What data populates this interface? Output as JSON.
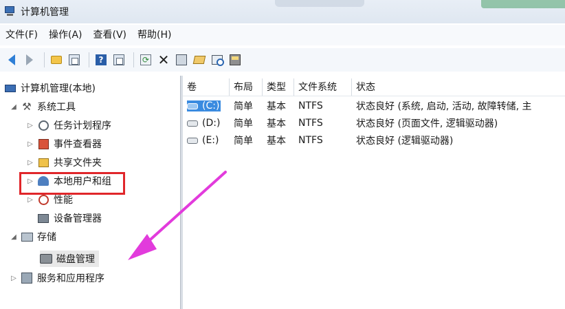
{
  "window": {
    "title": "计算机管理"
  },
  "menu": [
    {
      "label": "文件(F)"
    },
    {
      "label": "操作(A)"
    },
    {
      "label": "查看(V)"
    },
    {
      "label": "帮助(H)"
    }
  ],
  "toolbar": {
    "icons": [
      "back-arrow-icon",
      "forward-arrow-icon",
      "up-folder-icon",
      "show-hide-tree-icon",
      "help-icon",
      "show-action-pane-icon",
      "refresh-icon",
      "delete-icon",
      "properties-icon",
      "open-icon",
      "search-icon",
      "disk-icon"
    ]
  },
  "tree": {
    "root": {
      "label": "计算机管理(本地)"
    },
    "system_tools": {
      "label": "系统工具"
    },
    "task_scheduler": {
      "label": "任务计划程序"
    },
    "event_viewer": {
      "label": "事件查看器"
    },
    "shared_folders": {
      "label": "共享文件夹"
    },
    "local_users": {
      "label": "本地用户和组"
    },
    "performance": {
      "label": "性能"
    },
    "device_manager": {
      "label": "设备管理器"
    },
    "storage": {
      "label": "存储"
    },
    "disk_management": {
      "label": "磁盘管理"
    },
    "services": {
      "label": "服务和应用程序"
    }
  },
  "volumes": {
    "headers": {
      "volume": "卷",
      "layout": "布局",
      "type": "类型",
      "fs": "文件系统",
      "status": "状态"
    },
    "rows": [
      {
        "volume": "(C:)",
        "layout": "简单",
        "type": "基本",
        "fs": "NTFS",
        "status": "状态良好 (系统, 启动, 活动, 故障转储, 主"
      },
      {
        "volume": "(D:)",
        "layout": "简单",
        "type": "基本",
        "fs": "NTFS",
        "status": "状态良好 (页面文件, 逻辑驱动器)"
      },
      {
        "volume": "(E:)",
        "layout": "简单",
        "type": "基本",
        "fs": "NTFS",
        "status": "状态良好 (逻辑驱动器)"
      }
    ]
  },
  "colors": {
    "highlight_box": "#e0262a",
    "annotation_arrow": "#e23bdc",
    "selection": "#3a8be0"
  }
}
